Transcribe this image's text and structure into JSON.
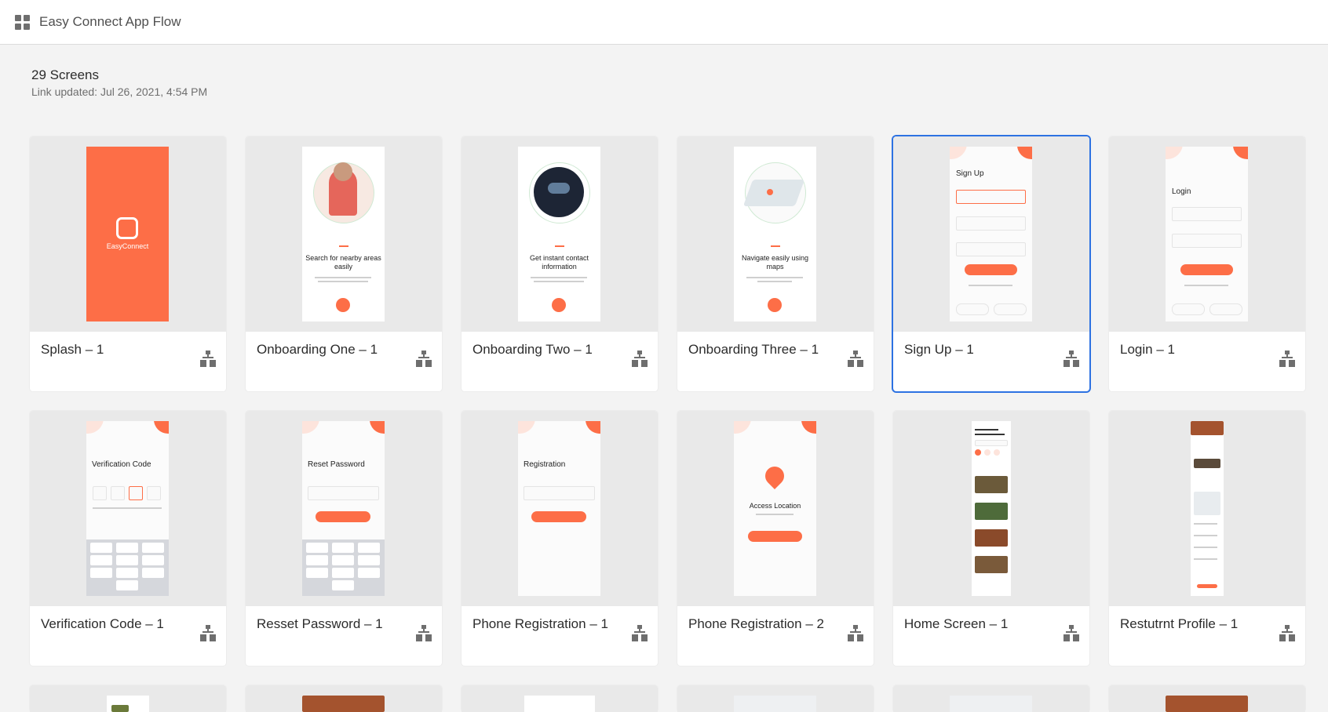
{
  "header": {
    "title": "Easy Connect App Flow",
    "icon": "grid-icon"
  },
  "summary": {
    "count": "29 Screens",
    "updated": "Link updated: Jul 26, 2021, 4:54 PM"
  },
  "colors": {
    "accent": "#fd6e47",
    "selection": "#2d72e2",
    "background": "#f3f3f3"
  },
  "cards": [
    {
      "label": "Splash – 1",
      "brand": "EasyConnect"
    },
    {
      "label": "Onboarding One – 1",
      "heading": "Search for nearby areas easily"
    },
    {
      "label": "Onboarding Two – 1",
      "heading": "Get instant contact information"
    },
    {
      "label": "Onboarding Three – 1",
      "heading": "Navigate easily using maps"
    },
    {
      "label": "Sign Up – 1",
      "heading": "Sign Up",
      "selected": true
    },
    {
      "label": "Login – 1",
      "heading": "Login"
    },
    {
      "label": "Verification Code – 1",
      "heading": "Verification Code"
    },
    {
      "label": "Resset Password – 1",
      "heading": "Reset Password"
    },
    {
      "label": "Phone Registration – 1",
      "heading": "Registration"
    },
    {
      "label": "Phone Registration – 2",
      "heading": "Access Location"
    },
    {
      "label": "Home Screen – 1"
    },
    {
      "label": "Restutrnt Profile – 1"
    }
  ]
}
